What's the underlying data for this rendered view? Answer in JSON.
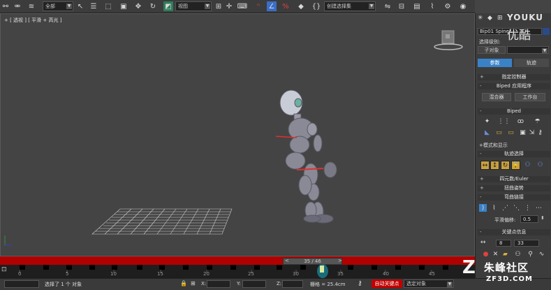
{
  "toolbar": {
    "selection_filter": "全部",
    "view_dropdown": "视图",
    "named_selection": "创建选择集"
  },
  "viewport": {
    "label": "+ [ 透视 ] [ 平滑 + 高光 ]"
  },
  "timeline": {
    "slider_text": "35 / 46",
    "ticks": [
      "0",
      "5",
      "10",
      "15",
      "20",
      "25",
      "30",
      "35",
      "40",
      "45"
    ]
  },
  "statusbar": {
    "selection_status": "选择了 1 个 对象",
    "x_label": "X:",
    "y_label": "Y:",
    "z_label": "Z:",
    "grid_text": "栅格 = 25.4cm",
    "auto_key": "自动关键点",
    "selected_objects": "选定对象"
  },
  "panel": {
    "object_name": "Bip01 Spine1",
    "selection_level_label": "选择级别:",
    "sub_object": "子对象",
    "tabs": [
      "参数",
      "轨迹"
    ],
    "rollouts": {
      "assign_controller": "指定控制器",
      "biped_app": "Biped 应用程序",
      "mixer": "混合器",
      "workbench": "工作台",
      "biped": "Biped",
      "mode_display": "+模式和显示",
      "track_selection": "轨迹选择",
      "quaternion_euler": "四元数/Euler",
      "twist_poses": "扭曲姿势",
      "bend_links": "弯曲链接",
      "smoothing_label": "平滑偏移:",
      "smoothing_value": "0.5",
      "key_info": "关键点信息",
      "key_number": "8",
      "key_time": "33"
    }
  },
  "watermarks": {
    "youku": "YOUKU",
    "youku_cn": "优酷",
    "community": "朱峰社区",
    "site": "ZF3D.COM"
  },
  "colors": {
    "viewport_bg": "#444444",
    "red_bar": "#b00000",
    "active_tab": "#3a82c8",
    "auto_key": "#c00000",
    "grid_lines": "#cfcfcf"
  }
}
